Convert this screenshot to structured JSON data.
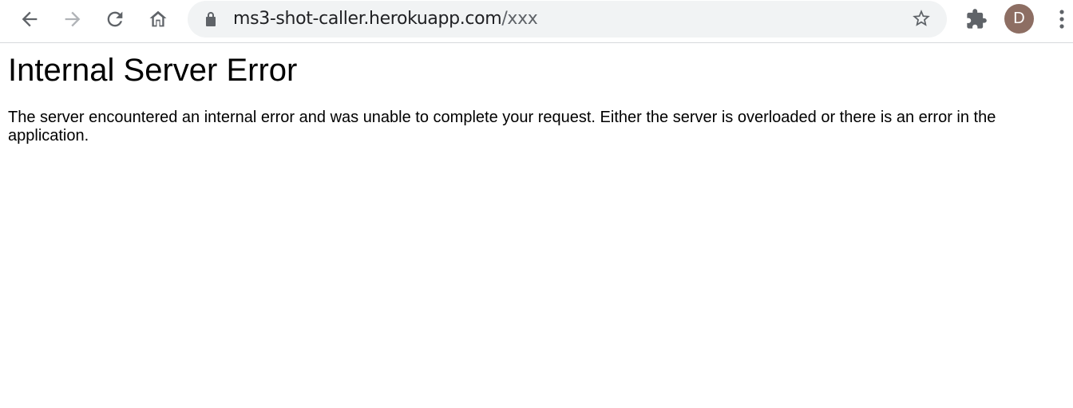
{
  "browser": {
    "url_host": "ms3-shot-caller.herokuapp.com",
    "url_path": "/xxx",
    "profile_initial": "D",
    "colors": {
      "avatar_bg": "#8d6e63",
      "omnibox_bg": "#f1f3f4",
      "icon": "#5f6368",
      "icon_disabled": "#b0b3b7"
    },
    "icons": [
      "back-arrow-icon",
      "forward-arrow-icon",
      "reload-icon",
      "home-icon",
      "lock-icon",
      "star-icon",
      "puzzle-icon",
      "kebab-menu-icon"
    ]
  },
  "page": {
    "heading": "Internal Server Error",
    "message": "The server encountered an internal error and was unable to complete your request. Either the server is overloaded or there is an error in the application."
  }
}
